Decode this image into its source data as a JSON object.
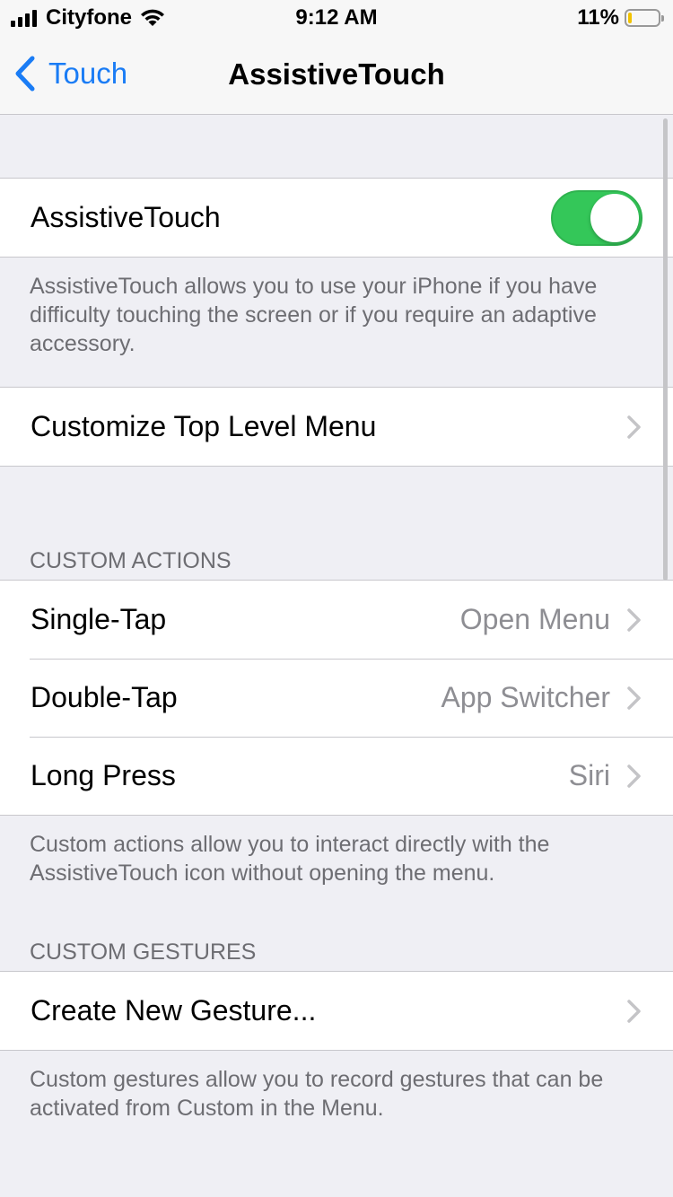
{
  "status_bar": {
    "carrier": "Cityfone",
    "time": "9:12 AM",
    "battery_percent": "11%",
    "battery_level": 0.11
  },
  "nav": {
    "back_label": "Touch",
    "title": "AssistiveTouch"
  },
  "assistive_touch": {
    "label": "AssistiveTouch",
    "enabled": true,
    "description": "AssistiveTouch allows you to use your iPhone if you have difficulty touching the screen or if you require an adaptive accessory."
  },
  "customize_menu": {
    "label": "Customize Top Level Menu"
  },
  "custom_actions": {
    "header": "CUSTOM ACTIONS",
    "rows": [
      {
        "label": "Single-Tap",
        "value": "Open Menu"
      },
      {
        "label": "Double-Tap",
        "value": "App Switcher"
      },
      {
        "label": "Long Press",
        "value": "Siri"
      }
    ],
    "footer": "Custom actions allow you to interact directly with the AssistiveTouch icon without opening the menu."
  },
  "custom_gestures": {
    "header": "CUSTOM GESTURES",
    "create_label": "Create New Gesture...",
    "footer": "Custom gestures allow you to record gestures that can be activated from Custom in the Menu."
  },
  "colors": {
    "accent": "#1a7cf5",
    "toggle_on": "#34c759",
    "background": "#efeff4",
    "secondary_text": "#8e8e93"
  }
}
